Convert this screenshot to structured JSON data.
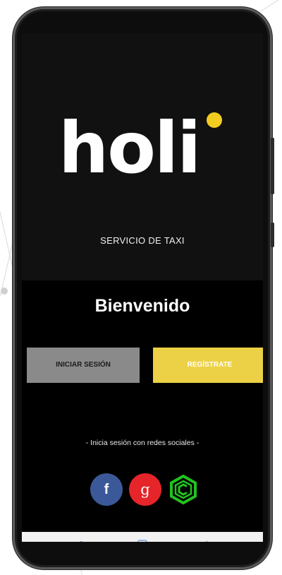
{
  "app": {
    "logo_text": "holi",
    "subtitle": "SERVICIO DE TAXI",
    "welcome": "Bienvenido",
    "accent_color": "#f2cd1f"
  },
  "buttons": {
    "login_label": "INICIAR SESIÓN",
    "register_label": "REGÍSTRATE"
  },
  "social": {
    "caption": "- Inicia sesión con redes sociales -",
    "items": [
      {
        "name": "facebook",
        "glyph": "f",
        "color": "#3b5998",
        "icon": "facebook-icon"
      },
      {
        "name": "google",
        "glyph": "g",
        "color": "#e5252a",
        "icon": "google-icon"
      },
      {
        "name": "hexagon-brand",
        "glyph": "",
        "color": "#22c31f",
        "icon": "hexagon-c-icon"
      }
    ]
  },
  "navbar": {
    "icons": [
      "recent-apps-icon",
      "home-icon",
      "back-icon"
    ],
    "icon_color": "#8fb3dd"
  }
}
